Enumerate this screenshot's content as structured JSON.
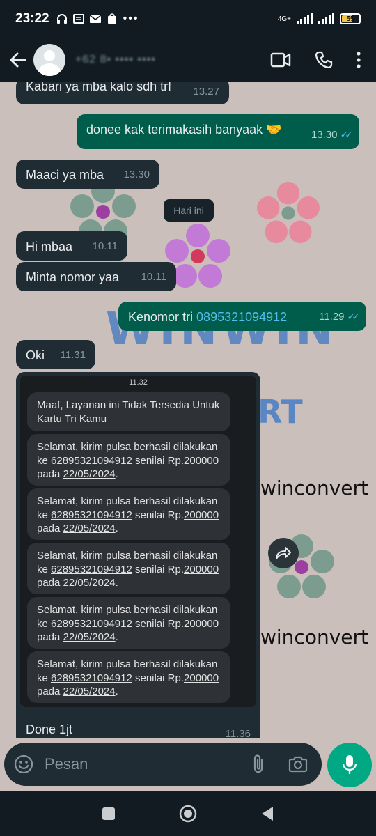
{
  "status_bar": {
    "time": "23:22",
    "network": "4G+",
    "battery": "55"
  },
  "header": {
    "contact_name": "+62 8• •••• ••••",
    "icons": [
      "back-arrow-icon",
      "video-call-icon",
      "voice-call-icon",
      "more-options-icon"
    ]
  },
  "chat": {
    "date_chip": "Hari ini",
    "messages": [
      {
        "direction": "in",
        "text": "Kabari ya mba kalo sdh trf",
        "time": "13.27"
      },
      {
        "direction": "out",
        "text": "donee kak terimakasih banyaak 🤝",
        "time": "13.30"
      },
      {
        "direction": "in",
        "text": "Maaci ya mba",
        "time": "13.30"
      },
      {
        "direction": "in",
        "text": "Hi mbaa",
        "time": "10.11"
      },
      {
        "direction": "in",
        "text": "Minta nomor yaa",
        "time": "10.11"
      },
      {
        "direction": "out",
        "text_prefix": "Kenomor tri ",
        "link": "0895321094912",
        "time": "11.29"
      },
      {
        "direction": "in",
        "text": "Oki",
        "time": "11.31"
      },
      {
        "direction": "in",
        "caption": "Done 1jt",
        "time": "11.36"
      }
    ],
    "screenshot": {
      "time": "11.32",
      "first_sms": "Maaf, Layanan ini Tidak Tersedia Untuk Kartu Tri Kamu",
      "sms_prefix": "Selamat, kirim pulsa berhasil dilakukan ke ",
      "sms_number": "62895321094912",
      "sms_mid1": " senilai Rp.",
      "sms_amount": "200000",
      "sms_mid2": " pada ",
      "sms_date": "22/05/2024",
      "sms_end": "."
    },
    "wallpaper_text": [
      "WINWIN",
      "RT",
      "winconvert",
      "winconvert"
    ]
  },
  "input": {
    "placeholder": "Pesan"
  },
  "colors": {
    "incoming": "#202c33",
    "outgoing": "#005c4b",
    "accent": "#00a884",
    "link": "#53bdeb",
    "wallpaper": "#cbbfbc"
  }
}
